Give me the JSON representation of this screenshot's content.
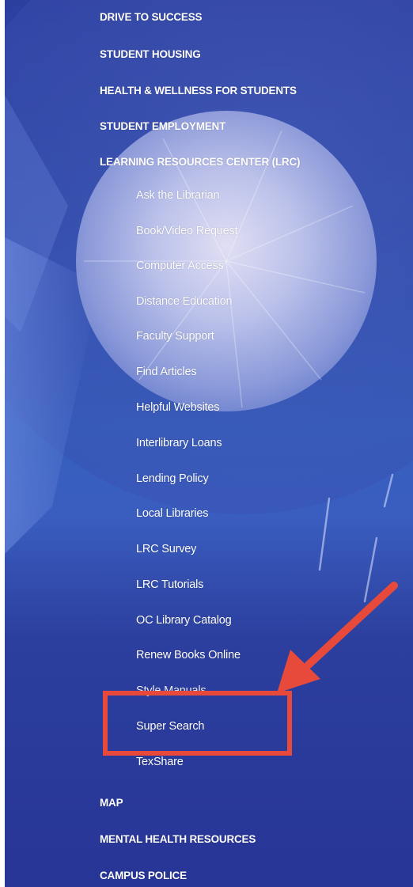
{
  "nav": {
    "top_items": [
      {
        "label": "DRIVE TO SUCCESS"
      },
      {
        "label": "STUDENT HOUSING"
      },
      {
        "label": "HEALTH & WELLNESS FOR STUDENTS"
      },
      {
        "label": "STUDENT EMPLOYMENT"
      },
      {
        "label": "LEARNING RESOURCES CENTER (LRC)"
      }
    ],
    "lrc_sub_items": [
      {
        "label": "Ask the Librarian"
      },
      {
        "label": "Book/Video Request"
      },
      {
        "label": "Computer Access"
      },
      {
        "label": "Distance Education"
      },
      {
        "label": "Faculty Support"
      },
      {
        "label": "Find Articles"
      },
      {
        "label": "Helpful Websites"
      },
      {
        "label": "Interlibrary Loans"
      },
      {
        "label": "Lending Policy"
      },
      {
        "label": "Local Libraries"
      },
      {
        "label": "LRC Survey"
      },
      {
        "label": "LRC Tutorials"
      },
      {
        "label": "OC Library Catalog"
      },
      {
        "label": "Renew Books Online"
      },
      {
        "label": "Style Manuals"
      },
      {
        "label": "Super Search"
      },
      {
        "label": "TexShare"
      }
    ],
    "bottom_items": [
      {
        "label": "MAP"
      },
      {
        "label": "MENTAL HEALTH RESOURCES"
      },
      {
        "label": "CAMPUS POLICE"
      }
    ]
  },
  "annotation": {
    "highlighted_item": "Super Search",
    "color": "#e74a3b"
  },
  "colors": {
    "background": "#2e44a4",
    "text": "#ffffff"
  }
}
